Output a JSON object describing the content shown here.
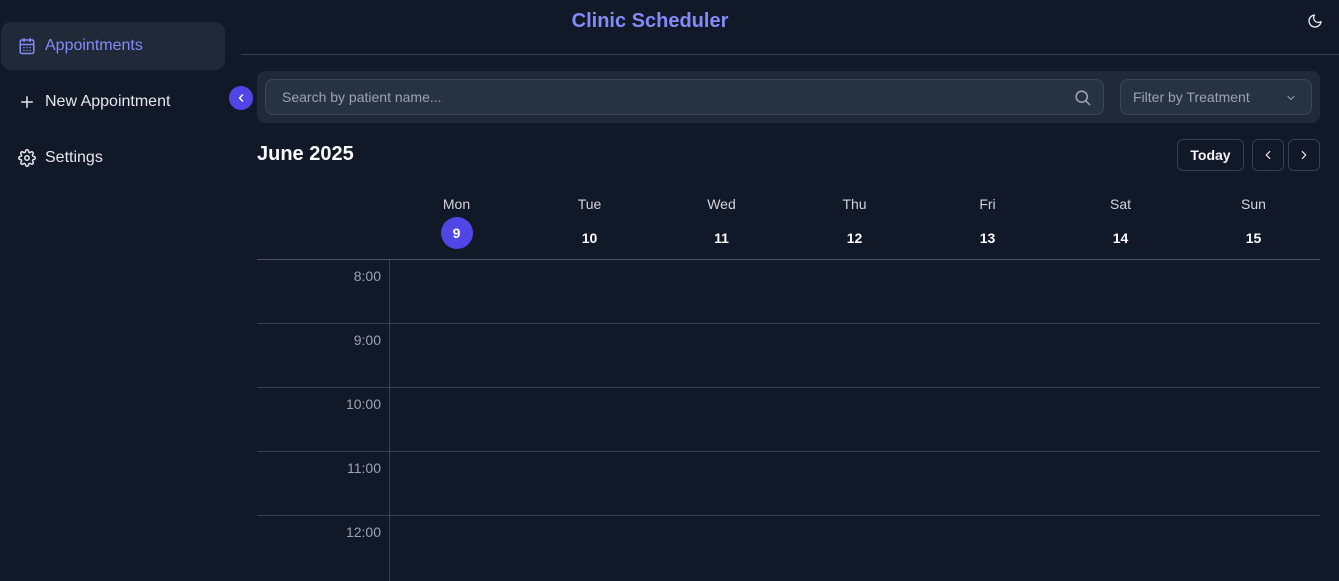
{
  "app": {
    "title": "Clinic Scheduler"
  },
  "sidebar": {
    "items": [
      {
        "label": "Appointments",
        "icon": "calendar-icon",
        "active": true
      },
      {
        "label": "New Appointment",
        "icon": "plus-icon",
        "active": false
      },
      {
        "label": "Settings",
        "icon": "gear-icon",
        "active": false
      }
    ]
  },
  "search": {
    "placeholder": "Search by patient name...",
    "value": ""
  },
  "filter": {
    "label": "Filter by Treatment"
  },
  "calendar": {
    "month_label": "June 2025",
    "today_label": "Today",
    "days": [
      {
        "name": "Mon",
        "num": "9",
        "today": true
      },
      {
        "name": "Tue",
        "num": "10"
      },
      {
        "name": "Wed",
        "num": "11"
      },
      {
        "name": "Thu",
        "num": "12"
      },
      {
        "name": "Fri",
        "num": "13"
      },
      {
        "name": "Sat",
        "num": "14"
      },
      {
        "name": "Sun",
        "num": "15"
      }
    ],
    "hours": [
      "8:00",
      "9:00",
      "10:00",
      "11:00",
      "12:00"
    ]
  },
  "colors": {
    "accent": "#818cf8",
    "primary": "#4f46e5",
    "background": "#111827",
    "panel": "#1f2937"
  }
}
